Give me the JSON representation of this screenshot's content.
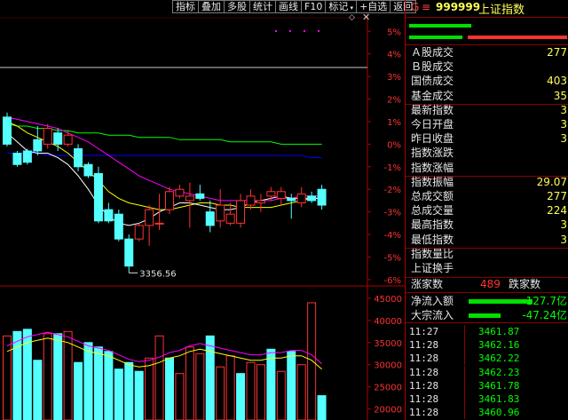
{
  "toolbar": {
    "buttons": [
      "指标",
      "叠加",
      "多股",
      "统计",
      "画线",
      "F10",
      "标记",
      "+自选",
      "返回"
    ]
  },
  "colors": {
    "up": "#ff3232",
    "down": "#54ffff",
    "ma5": "#ffffff",
    "ma10": "#ffff00",
    "ma20": "#ff00ff",
    "ma30": "#00ff00",
    "ma60": "#0000ff",
    "label_yellow": "#ffff55",
    "flow_green": "#00ff00",
    "axis_red": "#ff3232"
  },
  "header": {
    "mark": "G",
    "menu": "≡",
    "code": "999999",
    "name": "上证指数"
  },
  "chart_data": {
    "type": "candlestick",
    "price_axis": {
      "labels": [
        "5%",
        "4%",
        "3%",
        "2%",
        "1%",
        "0%",
        "-1%",
        "-2%",
        "-3%",
        "-4%",
        "-5%",
        "-6%"
      ],
      "range_pct": [
        -6.2,
        5.6
      ]
    },
    "low_annotation": "3356.56",
    "candles_pct": [
      {
        "o": 1.2,
        "c": 0.0,
        "h": 1.4,
        "l": -0.1
      },
      {
        "o": -0.4,
        "c": -0.9,
        "h": -0.3,
        "l": -1.0
      },
      {
        "o": -0.3,
        "c": -0.8,
        "h": -0.2,
        "l": -0.9
      },
      {
        "o": 0.2,
        "c": -0.3,
        "h": 0.8,
        "l": -0.5
      },
      {
        "o": 0.0,
        "c": 0.7,
        "h": 0.9,
        "l": -0.2
      },
      {
        "o": 0.5,
        "c": 0.0,
        "h": 0.7,
        "l": -0.3
      },
      {
        "o": 0.0,
        "c": 0.4,
        "h": 0.6,
        "l": -0.1
      },
      {
        "o": -0.2,
        "c": -1.0,
        "h": 0.0,
        "l": -1.2
      },
      {
        "o": -0.9,
        "c": -1.4,
        "h": -0.8,
        "l": -1.5
      },
      {
        "o": -1.3,
        "c": -3.4,
        "h": -1.0,
        "l": -3.5
      },
      {
        "o": -2.9,
        "c": -3.4,
        "h": -2.6,
        "l": -3.5
      },
      {
        "o": -3.1,
        "c": -4.2,
        "h": -2.9,
        "l": -4.3
      },
      {
        "o": -4.2,
        "c": -5.4,
        "h": -4.0,
        "l": -5.7
      },
      {
        "o": -4.2,
        "c": -3.6,
        "h": -3.5,
        "l": -4.3
      },
      {
        "o": -3.6,
        "c": -2.9,
        "h": -2.7,
        "l": -4.5
      },
      {
        "o": -3.5,
        "c": -3.5,
        "h": -2.2,
        "l": -3.8
      },
      {
        "o": -2.9,
        "c": -2.1,
        "h": -1.9,
        "l": -3.1
      },
      {
        "o": -2.3,
        "c": -2.0,
        "h": -1.8,
        "l": -2.4
      },
      {
        "o": -2.5,
        "c": -2.3,
        "h": -1.7,
        "l": -3.7
      },
      {
        "o": -2.2,
        "c": -2.4,
        "h": -1.8,
        "l": -2.5
      },
      {
        "o": -3.0,
        "c": -3.6,
        "h": -2.5,
        "l": -3.9
      },
      {
        "o": -3.4,
        "c": -2.7,
        "h": -2.0,
        "l": -3.7
      },
      {
        "o": -3.5,
        "c": -3.1,
        "h": -2.6,
        "l": -3.6
      },
      {
        "o": -3.5,
        "c": -2.5,
        "h": -2.2,
        "l": -3.7
      },
      {
        "o": -2.7,
        "c": -2.3,
        "h": -2.0,
        "l": -2.9
      },
      {
        "o": -2.6,
        "c": -2.5,
        "h": -2.2,
        "l": -3.0
      },
      {
        "o": -2.3,
        "c": -2.1,
        "h": -1.9,
        "l": -2.5
      },
      {
        "o": -2.4,
        "c": -2.1,
        "h": -1.9,
        "l": -2.7
      },
      {
        "o": -2.4,
        "c": -2.5,
        "h": -2.2,
        "l": -3.3
      },
      {
        "o": -2.6,
        "c": -2.2,
        "h": -1.9,
        "l": -2.8
      },
      {
        "o": -2.3,
        "c": -2.5,
        "h": -2.1,
        "l": -2.6
      },
      {
        "o": -2.0,
        "c": -2.7,
        "h": -1.8,
        "l": -2.9
      }
    ],
    "ma_lines_pct": {
      "ma5": [
        0.5,
        0.1,
        -0.3,
        -0.4,
        -0.4,
        -0.6,
        -0.9,
        -1.4,
        -2.0,
        -2.7,
        -3.2,
        -3.5,
        -3.6,
        -3.5,
        -3.3,
        -3.0,
        -2.8,
        -2.6,
        -2.6,
        -2.7,
        -2.8,
        -2.9,
        -2.9,
        -2.8,
        -2.6,
        -2.5,
        -2.4,
        -2.3,
        -2.4,
        -2.4,
        -2.4,
        -2.4
      ],
      "ma10": [
        1.0,
        0.8,
        0.5,
        0.3,
        0.1,
        -0.1,
        -0.4,
        -0.8,
        -1.2,
        -1.6,
        -2.1,
        -2.4,
        -2.6,
        -2.7,
        -2.8,
        -2.9,
        -2.9,
        -2.8,
        -2.7,
        -2.6,
        -2.6,
        -2.7,
        -2.7,
        -2.8,
        -2.8,
        -2.8,
        -2.8,
        -2.7,
        -2.6,
        -2.5,
        -2.4,
        -2.4
      ],
      "ma20": [
        1.2,
        1.1,
        1.0,
        0.9,
        0.8,
        0.7,
        0.5,
        0.3,
        0.1,
        -0.2,
        -0.5,
        -0.8,
        -1.1,
        -1.4,
        -1.6,
        -1.8,
        -2.0,
        -2.1,
        -2.2,
        -2.3,
        -2.4,
        -2.5,
        -2.5,
        -2.5,
        -2.5,
        -2.5,
        -2.5,
        -2.4,
        -2.4,
        -2.3,
        -2.3,
        -2.3
      ],
      "ma30": [
        0.9,
        0.8,
        0.8,
        0.7,
        0.7,
        0.6,
        0.6,
        0.5,
        0.5,
        0.5,
        0.4,
        0.4,
        0.4,
        0.3,
        0.3,
        0.3,
        0.3,
        0.2,
        0.2,
        0.2,
        0.2,
        0.2,
        0.1,
        0.1,
        0.1,
        0.1,
        0.1,
        0.0,
        0.0,
        0.0,
        0.0,
        0.0
      ],
      "ma60": [
        -0.4,
        -0.4,
        -0.4,
        -0.4,
        -0.5,
        -0.5,
        -0.5,
        -0.5,
        -0.5,
        -0.5,
        -0.5,
        -0.5,
        -0.5,
        -0.5,
        -0.5,
        -0.5,
        -0.5,
        -0.5,
        -0.5,
        -0.5,
        -0.5,
        -0.5,
        -0.5,
        -0.5,
        -0.5,
        -0.5,
        -0.5,
        -0.5,
        -0.5,
        -0.5,
        -0.6,
        -0.6
      ]
    },
    "volume_axis": {
      "labels": [
        "45000",
        "40000",
        "35000",
        "30000",
        "25000",
        "20000"
      ],
      "range": [
        17500,
        47000
      ]
    },
    "volume": [
      {
        "v": 36500,
        "d": 0
      },
      {
        "v": 37500,
        "d": 1
      },
      {
        "v": 38000,
        "d": 1
      },
      {
        "v": 31000,
        "d": 1
      },
      {
        "v": 37000,
        "d": 0
      },
      {
        "v": 37000,
        "d": 1
      },
      {
        "v": 37500,
        "d": 0
      },
      {
        "v": 30500,
        "d": 1
      },
      {
        "v": 35000,
        "d": 1
      },
      {
        "v": 34000,
        "d": 1
      },
      {
        "v": 33000,
        "d": 1
      },
      {
        "v": 29000,
        "d": 1
      },
      {
        "v": 30500,
        "d": 1
      },
      {
        "v": 28500,
        "d": 1
      },
      {
        "v": 31500,
        "d": 0
      },
      {
        "v": 36500,
        "d": 0
      },
      {
        "v": 31500,
        "d": 1
      },
      {
        "v": 28000,
        "d": 0
      },
      {
        "v": 34000,
        "d": 0
      },
      {
        "v": 32500,
        "d": 0
      },
      {
        "v": 36500,
        "d": 1
      },
      {
        "v": 29500,
        "d": 0
      },
      {
        "v": 32000,
        "d": 0
      },
      {
        "v": 28000,
        "d": 1
      },
      {
        "v": 30500,
        "d": 0
      },
      {
        "v": 30000,
        "d": 0
      },
      {
        "v": 33500,
        "d": 1
      },
      {
        "v": 28500,
        "d": 0
      },
      {
        "v": 33000,
        "d": 1
      },
      {
        "v": 30000,
        "d": 0
      },
      {
        "v": 44000,
        "d": 0
      },
      {
        "v": 23000,
        "d": 1
      }
    ],
    "volume_ma": [
      33000,
      34000,
      35000,
      35500,
      36000,
      35500,
      35000,
      34000,
      33000,
      32500,
      32000,
      31000,
      30000,
      29500,
      29800,
      30500,
      31500,
      32000,
      33000,
      33500,
      33000,
      32500,
      32000,
      31500,
      31000,
      31000,
      31500,
      31500,
      32000,
      32000,
      31000,
      29000
    ]
  },
  "stats": [
    {
      "label": "Ａ股成交",
      "value": "277"
    },
    {
      "label": "Ｂ股成交",
      "value": ""
    },
    {
      "label": "国债成交",
      "value": "403"
    },
    {
      "label": "基金成交",
      "value": "35"
    },
    {
      "label": "最新指数",
      "value": "3"
    },
    {
      "label": "今日开盘",
      "value": "3"
    },
    {
      "label": "昨日收盘",
      "value": "3"
    },
    {
      "label": "指数涨跌",
      "value": ""
    },
    {
      "label": "指数涨幅",
      "value": ""
    },
    {
      "label": "指数振幅",
      "value": "29.07"
    },
    {
      "label": "总成交额",
      "value": "277"
    },
    {
      "label": "总成交量",
      "value": "224"
    },
    {
      "label": "最高指数",
      "value": "3"
    },
    {
      "label": "最低指数",
      "value": "3"
    },
    {
      "label": "指数量比",
      "value": ""
    },
    {
      "label": "上证换手",
      "value": ""
    }
  ],
  "updown": {
    "up_label": "涨家数",
    "up_value": "489",
    "down_label": "跌家数"
  },
  "flows": [
    {
      "label": "净流入额",
      "value": "-127.7亿",
      "level": 0.9
    },
    {
      "label": "大宗流入",
      "value": "-47.24亿",
      "level": 0.45
    }
  ],
  "ticks": [
    {
      "time": "11:27",
      "price": "3461.87"
    },
    {
      "time": "11:28",
      "price": "3462.16"
    },
    {
      "time": "11:28",
      "price": "3462.22"
    },
    {
      "time": "11:28",
      "price": "3462.23"
    },
    {
      "time": "11:28",
      "price": "3461.78"
    },
    {
      "time": "11:28",
      "price": "3461.83"
    },
    {
      "time": "11:28",
      "price": "3460.96"
    }
  ]
}
